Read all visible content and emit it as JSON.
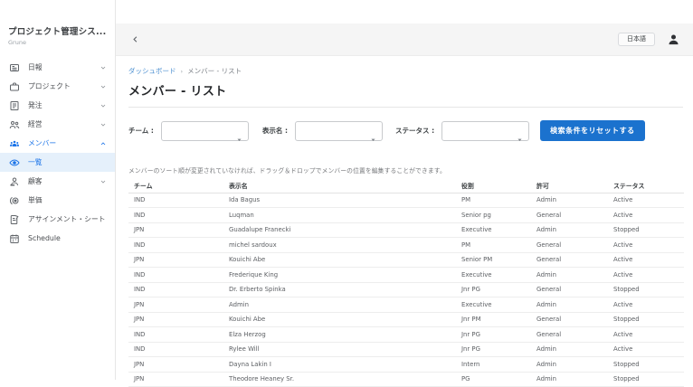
{
  "app": {
    "title": "プロジェクト管理シス...",
    "subtitle": "Grune"
  },
  "sidebar": {
    "items": [
      {
        "label": "日報"
      },
      {
        "label": "プロジェクト"
      },
      {
        "label": "発注"
      },
      {
        "label": "経営"
      },
      {
        "label": "メンバー"
      },
      {
        "label": "一覧"
      },
      {
        "label": "顧客"
      },
      {
        "label": "単価"
      },
      {
        "label": "アサインメント・シート"
      },
      {
        "label": "Schedule"
      }
    ]
  },
  "header": {
    "language_button": "日本語"
  },
  "breadcrumb": {
    "link": "ダッシュボード",
    "separator": "›",
    "current": "メンバー - リスト"
  },
  "page": {
    "title": "メンバー - リスト",
    "note": "メンバーのソート順が変更されていなければ、ドラッグ＆ドロップでメンバーの位置を編集することができます。"
  },
  "filters": {
    "team_label": "チーム :",
    "display_name_label": "表示名 :",
    "status_label": "ステータス :",
    "reset_button": "検索条件をリセットする"
  },
  "table": {
    "headers": [
      "チーム",
      "表示名",
      "役割",
      "許可",
      "ステータス"
    ],
    "rows": [
      {
        "team": "IND",
        "name": "Ida Bagus",
        "role": "PM",
        "permission": "Admin",
        "status": "Active"
      },
      {
        "team": "IND",
        "name": "Luqman",
        "role": "Senior pg",
        "permission": "General",
        "status": "Active"
      },
      {
        "team": "JPN",
        "name": "Guadalupe Franecki",
        "role": "Executive",
        "permission": "Admin",
        "status": "Stopped"
      },
      {
        "team": "IND",
        "name": "michel sardoux",
        "role": "PM",
        "permission": "General",
        "status": "Active"
      },
      {
        "team": "JPN",
        "name": "Kouichi Abe",
        "role": "Senior PM",
        "permission": "General",
        "status": "Active"
      },
      {
        "team": "IND",
        "name": "Frederique King",
        "role": "Executive",
        "permission": "Admin",
        "status": "Active"
      },
      {
        "team": "IND",
        "name": "Dr. Erberto Spinka",
        "role": "Jnr PG",
        "permission": "General",
        "status": "Stopped"
      },
      {
        "team": "JPN",
        "name": "Admin",
        "role": "Executive",
        "permission": "Admin",
        "status": "Active"
      },
      {
        "team": "JPN",
        "name": "Kouichi Abe",
        "role": "Jnr PM",
        "permission": "General",
        "status": "Stopped"
      },
      {
        "team": "IND",
        "name": "Elza Herzog",
        "role": "Jnr PG",
        "permission": "General",
        "status": "Active"
      },
      {
        "team": "IND",
        "name": "Rylee Will",
        "role": "Jnr PG",
        "permission": "Admin",
        "status": "Active"
      },
      {
        "team": "JPN",
        "name": "Dayna Lakin I",
        "role": "Intern",
        "permission": "Admin",
        "status": "Stopped"
      },
      {
        "team": "JPN",
        "name": "Theodore Heaney Sr.",
        "role": "PG",
        "permission": "Admin",
        "status": "Stopped"
      }
    ]
  },
  "colors": {
    "accent_button": "#1b72ce",
    "sidebar_active": "#1a73e8",
    "sidebar_active_bg": "#e5f0fb",
    "breadcrumb_link": "#4d90d1",
    "topbar_bg": "#f5f5f5"
  }
}
